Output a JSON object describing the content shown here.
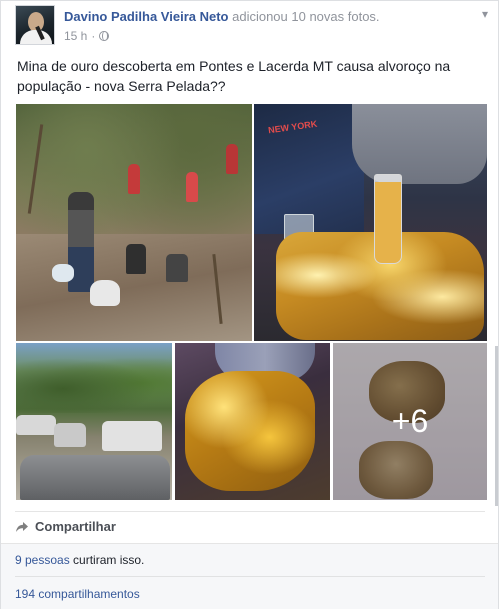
{
  "post": {
    "author": "Davino Padilha Vieira Neto",
    "action": "adicionou 10 novas fotos.",
    "time": "15 h",
    "separator": "·",
    "text": "Mina de ouro descoberta em Pontes e Lacerda MT causa alvoroço na população - nova Serra Pelada??",
    "photos": {
      "more_count": "+6",
      "shirt_text": "NEW YORK"
    }
  },
  "actions": {
    "share_label": "Compartilhar"
  },
  "stats": {
    "likes_link": "9 pessoas",
    "likes_suffix": " curtiram isso.",
    "shares": "194 compartilhamentos"
  },
  "icons": {
    "menu": "chevron-down-icon",
    "privacy": "globe-icon",
    "share": "share-arrow-icon"
  },
  "colors": {
    "link": "#365899",
    "muted": "#90949c",
    "text": "#1d2129"
  }
}
